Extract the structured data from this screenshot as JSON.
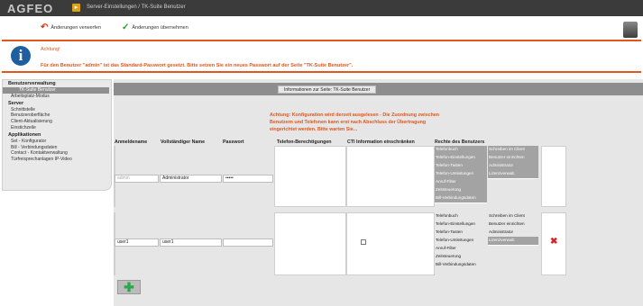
{
  "header": {
    "logo": "AGFEO",
    "breadcrumb": "Server-Einstellungen / TK-Suite Benutzer",
    "menu_label": "Menü"
  },
  "toolbar": {
    "discard_label": "Änderungen verwerfen",
    "apply_label": "Änderungen übernehmen"
  },
  "alert": {
    "title": "Achtung!",
    "message": "Für den Benutzer \"admin\" ist das Standard-Passwort gesetzt. Bitte setzen Sie ein neues Passwort auf der Seite \"TK-Suite Benutzer\"."
  },
  "sidebar": {
    "sections": [
      {
        "title": "Benutzerverwaltung",
        "items": [
          "TK-Suite Benutzer",
          "Arbeitsplatz-Modus"
        ]
      },
      {
        "title": "Server",
        "items": [
          "Schnittstelle",
          "Benutzeroberfläche",
          "Client-Aktualisierung",
          "Einstichzeile"
        ]
      },
      {
        "title": "Applikationen",
        "items": [
          "Set - Konfigurator",
          "Bill - Verbindungsdaten",
          "Contact - Kontaktverwaltung",
          "Türfreisprechanlagen IP-Video"
        ]
      }
    ]
  },
  "content": {
    "info_button": "Informationen zur Seite: TK-Suite Benutzer",
    "warning": [
      "Achtung: Konfiguration wird derzeit ausgelesen - Die Zuordnung zwischen",
      "Benutzern und Telefonen kann erst nach Abschluss der Übertragung",
      "eingerichtet werden. Bitte warten Sie..."
    ],
    "columns": [
      "Anmeldename",
      "Vollständiger Name",
      "Passwort",
      "Telefon-Berechtigungen",
      "CTI Information einschränken",
      "Rechte des Benutzers"
    ],
    "users": [
      {
        "login": "admin",
        "full_name": "Administrator",
        "password": "•••••",
        "cti_restricted": false,
        "rights_left": [
          "Telefonbuch",
          "Telefon-Einstellungen",
          "Telefon-Tasten",
          "Telefon-Umleitungen",
          "Anruf-Filter",
          "Zeitsteuerung",
          "Bill-Verbindungsdaten"
        ],
        "rights_right": [
          "Schreiben im Client",
          "Benutzer einrichten",
          "Administrator",
          "Lizenzverwalt."
        ]
      },
      {
        "login": "user1",
        "full_name": "user1",
        "password": "",
        "cti_restricted": false,
        "rights_left": [
          "Telefonbuch",
          "Telefon-Einstellungen",
          "Telefon-Tasten",
          "Telefon-Umleitungen",
          "Anruf-Filter",
          "Zeitsteuerung",
          "Bill-Verbindungsdaten"
        ],
        "rights_right": [
          "Schreiben im Client",
          "Benutzer einrichten",
          "Administrator",
          "Lizenzverwalt."
        ]
      }
    ]
  },
  "colors": {
    "accent": "#e0561c",
    "header_bg": "#3b3b3b",
    "info_blue": "#1f5fa0"
  }
}
